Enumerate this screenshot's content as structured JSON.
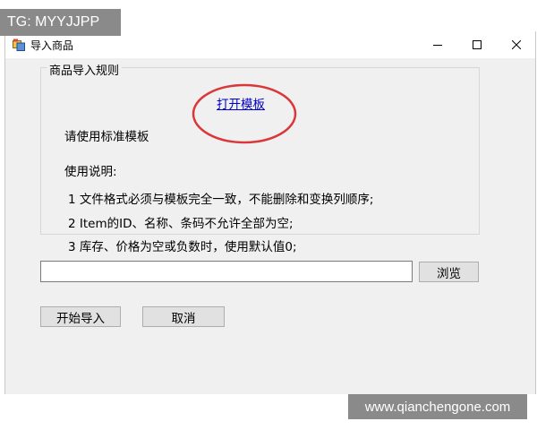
{
  "window": {
    "title": "导入商品",
    "icon": "app-window-icon",
    "controls": [
      "minimize-icon",
      "maximize-icon",
      "close-icon"
    ]
  },
  "group": {
    "legend": "商品导入规则",
    "template_label": "请使用标准模板",
    "template_link": "打开模板",
    "usage_title": "使用说明:",
    "rules": [
      "1  文件格式必须与模板完全一致，不能删除和变换列顺序;",
      "2  Item的ID、名称、条码不允许全部为空;",
      "3  库存、价格为空或负数时，使用默认值0;"
    ]
  },
  "file": {
    "path_value": "",
    "browse_label": "浏览"
  },
  "actions": {
    "start_label": "开始导入",
    "cancel_label": "取消"
  },
  "watermarks": {
    "top_left": "TG: MYYJJPP",
    "bottom_right": "www.qianchengone.com"
  },
  "colors": {
    "link": "#0000cc",
    "highlight_oval": "#d9383a",
    "dialog_bg": "#f0f0f0",
    "button_bg": "#e1e1e1"
  }
}
